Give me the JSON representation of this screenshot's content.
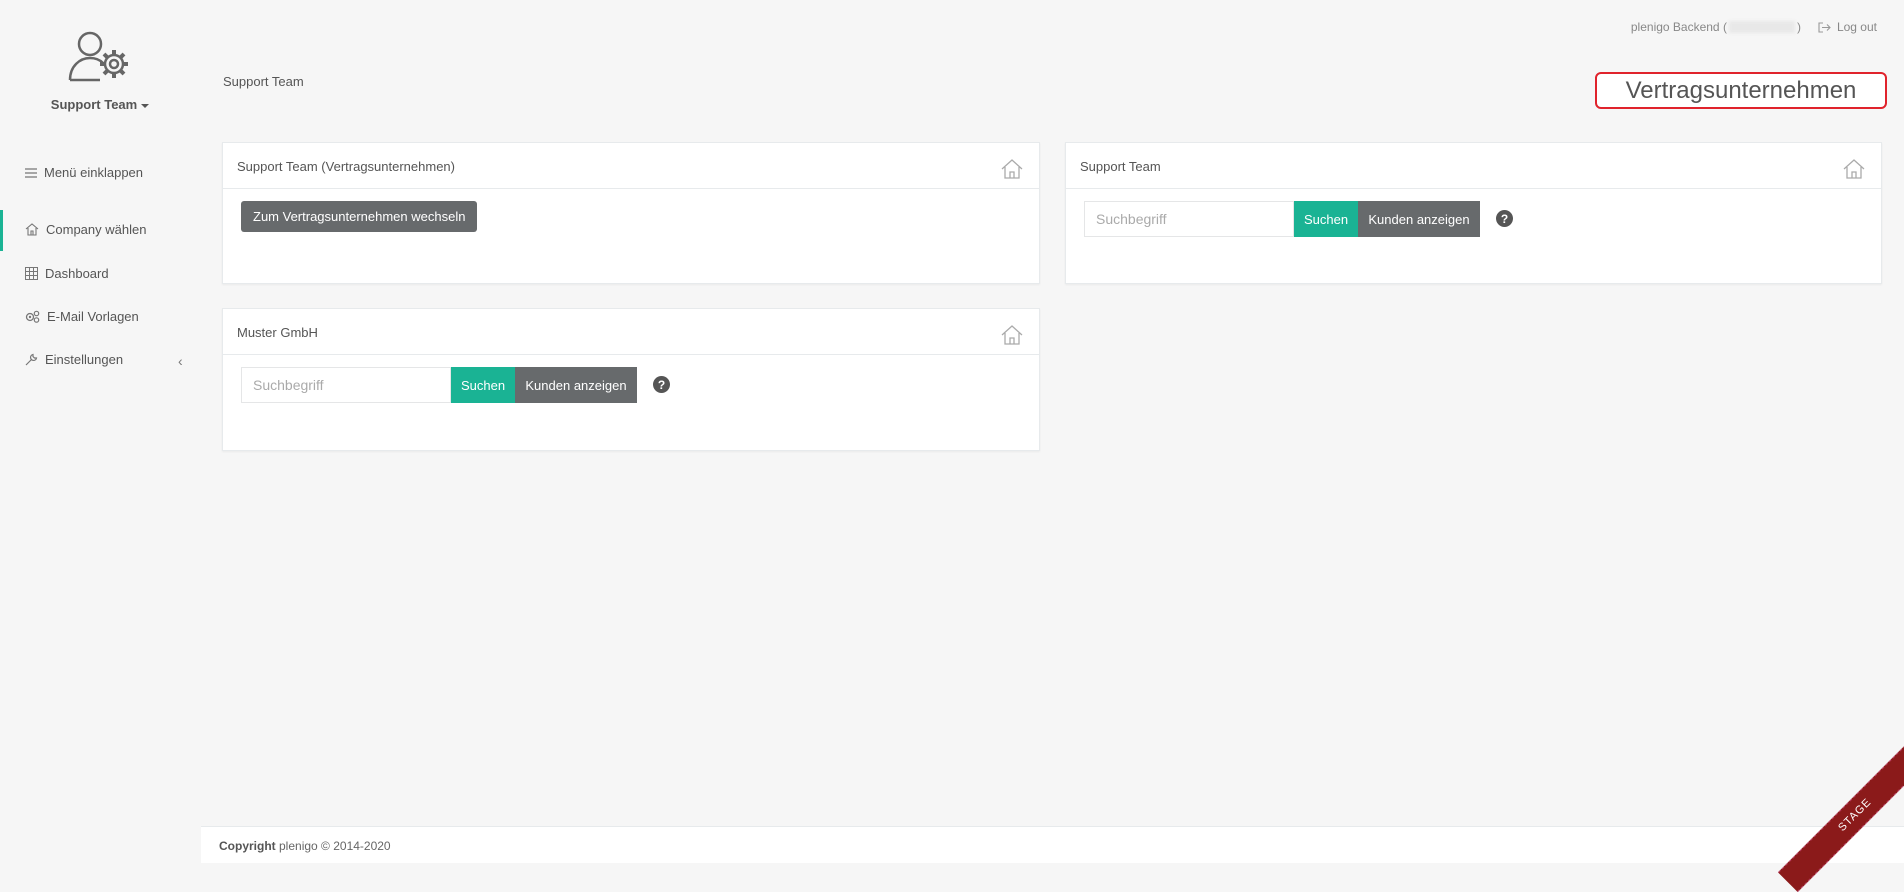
{
  "sidebar": {
    "user_name": "Support Team",
    "collapse_label": "Menü einklappen",
    "items": [
      {
        "label": "Company wählen"
      },
      {
        "label": "Dashboard"
      },
      {
        "label": "E-Mail Vorlagen"
      },
      {
        "label": "Einstellungen"
      }
    ]
  },
  "header": {
    "backend_label": "plenigo Backend (",
    "backend_suffix": ")",
    "logout_label": "Log out",
    "breadcrumb": "Support Team",
    "company_label": "Vertragsunternehmen"
  },
  "panels": {
    "contract": {
      "title": "Support Team (Vertragsunternehmen)",
      "switch_button": "Zum Vertragsunternehmen wechseln"
    },
    "support": {
      "title": "Support Team",
      "search_placeholder": "Suchbegriff",
      "search_button": "Suchen",
      "show_button": "Kunden anzeigen",
      "help": "?"
    },
    "muster": {
      "title": "Muster GmbH",
      "search_placeholder": "Suchbegriff",
      "search_button": "Suchen",
      "show_button": "Kunden anzeigen",
      "help": "?"
    }
  },
  "footer": {
    "copyright_label": "Copyright",
    "copyright_text": " plenigo © 2014-2020",
    "ribbon": "STAGE"
  },
  "colors": {
    "accent": "#1ab394",
    "highlight_border": "#e0232c",
    "dark_button": "#676a6c",
    "ribbon": "#8b1a1a"
  }
}
